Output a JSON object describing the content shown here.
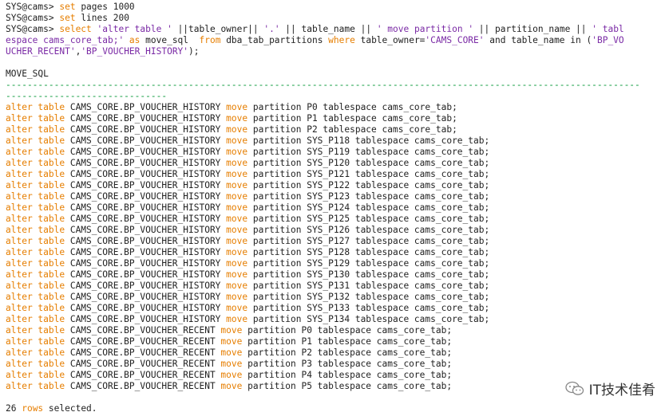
{
  "terminal": {
    "prompt1": {
      "prompt": "SYS@cams> ",
      "kw": "set",
      "rest": " pages 1000"
    },
    "prompt2": {
      "prompt": "SYS@cams> ",
      "kw": "set",
      "rest": " lines 200"
    },
    "query": {
      "prompt": "SYS@cams> ",
      "select": "select",
      "s1": " 'alter table '",
      "p1": " ||table_owner|| ",
      "s2": "'.'",
      "p2": " || table_name || ",
      "s3": "' move partition '",
      "p3": " || partition_name || ",
      "s4a": "' tabl",
      "s4b": "espace cams_core_tab;'",
      "as": " as",
      "p4": " move_sql  ",
      "from": "from",
      "p5": " dba_tab_partitions ",
      "where": "where",
      "p6": " table_owner=",
      "s5": "'CAMS_CORE'",
      "p7": " and table_name in (",
      "s6a": "'BP_VO",
      "s6b": "UCHER_RECENT'",
      "p8": ",",
      "s7": "'BP_VOUCHER_HISTORY'",
      "p9": ");"
    },
    "column_header": "MOVE_SQL",
    "separator1": "----------------------------------------------------------------------------------------------------------------------",
    "separator2": "------------------------------",
    "rows": [
      {
        "a": "alter table",
        "tbl": " CAMS_CORE.BP_VOUCHER_HISTORY ",
        "m": "move",
        "rest": " partition P0 tablespace cams_core_tab;"
      },
      {
        "a": "alter table",
        "tbl": " CAMS_CORE.BP_VOUCHER_HISTORY ",
        "m": "move",
        "rest": " partition P1 tablespace cams_core_tab;"
      },
      {
        "a": "alter table",
        "tbl": " CAMS_CORE.BP_VOUCHER_HISTORY ",
        "m": "move",
        "rest": " partition P2 tablespace cams_core_tab;"
      },
      {
        "a": "alter table",
        "tbl": " CAMS_CORE.BP_VOUCHER_HISTORY ",
        "m": "move",
        "rest": " partition SYS_P118 tablespace cams_core_tab;"
      },
      {
        "a": "alter table",
        "tbl": " CAMS_CORE.BP_VOUCHER_HISTORY ",
        "m": "move",
        "rest": " partition SYS_P119 tablespace cams_core_tab;"
      },
      {
        "a": "alter table",
        "tbl": " CAMS_CORE.BP_VOUCHER_HISTORY ",
        "m": "move",
        "rest": " partition SYS_P120 tablespace cams_core_tab;"
      },
      {
        "a": "alter table",
        "tbl": " CAMS_CORE.BP_VOUCHER_HISTORY ",
        "m": "move",
        "rest": " partition SYS_P121 tablespace cams_core_tab;"
      },
      {
        "a": "alter table",
        "tbl": " CAMS_CORE.BP_VOUCHER_HISTORY ",
        "m": "move",
        "rest": " partition SYS_P122 tablespace cams_core_tab;"
      },
      {
        "a": "alter table",
        "tbl": " CAMS_CORE.BP_VOUCHER_HISTORY ",
        "m": "move",
        "rest": " partition SYS_P123 tablespace cams_core_tab;"
      },
      {
        "a": "alter table",
        "tbl": " CAMS_CORE.BP_VOUCHER_HISTORY ",
        "m": "move",
        "rest": " partition SYS_P124 tablespace cams_core_tab;"
      },
      {
        "a": "alter table",
        "tbl": " CAMS_CORE.BP_VOUCHER_HISTORY ",
        "m": "move",
        "rest": " partition SYS_P125 tablespace cams_core_tab;"
      },
      {
        "a": "alter table",
        "tbl": " CAMS_CORE.BP_VOUCHER_HISTORY ",
        "m": "move",
        "rest": " partition SYS_P126 tablespace cams_core_tab;"
      },
      {
        "a": "alter table",
        "tbl": " CAMS_CORE.BP_VOUCHER_HISTORY ",
        "m": "move",
        "rest": " partition SYS_P127 tablespace cams_core_tab;"
      },
      {
        "a": "alter table",
        "tbl": " CAMS_CORE.BP_VOUCHER_HISTORY ",
        "m": "move",
        "rest": " partition SYS_P128 tablespace cams_core_tab;"
      },
      {
        "a": "alter table",
        "tbl": " CAMS_CORE.BP_VOUCHER_HISTORY ",
        "m": "move",
        "rest": " partition SYS_P129 tablespace cams_core_tab;"
      },
      {
        "a": "alter table",
        "tbl": " CAMS_CORE.BP_VOUCHER_HISTORY ",
        "m": "move",
        "rest": " partition SYS_P130 tablespace cams_core_tab;"
      },
      {
        "a": "alter table",
        "tbl": " CAMS_CORE.BP_VOUCHER_HISTORY ",
        "m": "move",
        "rest": " partition SYS_P131 tablespace cams_core_tab;"
      },
      {
        "a": "alter table",
        "tbl": " CAMS_CORE.BP_VOUCHER_HISTORY ",
        "m": "move",
        "rest": " partition SYS_P132 tablespace cams_core_tab;"
      },
      {
        "a": "alter table",
        "tbl": " CAMS_CORE.BP_VOUCHER_HISTORY ",
        "m": "move",
        "rest": " partition SYS_P133 tablespace cams_core_tab;"
      },
      {
        "a": "alter table",
        "tbl": " CAMS_CORE.BP_VOUCHER_HISTORY ",
        "m": "move",
        "rest": " partition SYS_P134 tablespace cams_core_tab;"
      },
      {
        "a": "alter table",
        "tbl": " CAMS_CORE.BP_VOUCHER_RECENT ",
        "m": "move",
        "rest": " partition P0 tablespace cams_core_tab;"
      },
      {
        "a": "alter table",
        "tbl": " CAMS_CORE.BP_VOUCHER_RECENT ",
        "m": "move",
        "rest": " partition P1 tablespace cams_core_tab;"
      },
      {
        "a": "alter table",
        "tbl": " CAMS_CORE.BP_VOUCHER_RECENT ",
        "m": "move",
        "rest": " partition P2 tablespace cams_core_tab;"
      },
      {
        "a": "alter table",
        "tbl": " CAMS_CORE.BP_VOUCHER_RECENT ",
        "m": "move",
        "rest": " partition P3 tablespace cams_core_tab;"
      },
      {
        "a": "alter table",
        "tbl": " CAMS_CORE.BP_VOUCHER_RECENT ",
        "m": "move",
        "rest": " partition P4 tablespace cams_core_tab;"
      },
      {
        "a": "alter table",
        "tbl": " CAMS_CORE.BP_VOUCHER_RECENT ",
        "m": "move",
        "rest": " partition P5 tablespace cams_core_tab;"
      }
    ],
    "footer": {
      "count": "26",
      "kw": " rows",
      "rest": " selected."
    }
  },
  "watermark": {
    "icon": "wechat-icon",
    "text": "IT技术佳肴"
  },
  "colors": {
    "keyword": "#e67e00",
    "string": "#7a2aa5",
    "separator": "#0a9a3a",
    "text": "#222222"
  }
}
